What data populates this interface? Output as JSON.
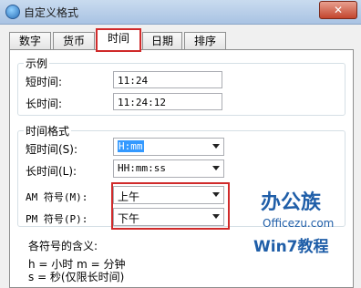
{
  "window": {
    "title": "自定义格式",
    "close_label": "✕"
  },
  "tabs": [
    {
      "label": "数字"
    },
    {
      "label": "货币"
    },
    {
      "label": "时间"
    },
    {
      "label": "日期"
    },
    {
      "label": "排序"
    }
  ],
  "example": {
    "group_title": "示例",
    "short_label": "短时间:",
    "short_value": "11:24",
    "long_label": "长时间:",
    "long_value": "11:24:12"
  },
  "time_format": {
    "group_title": "时间格式",
    "short_label": "短时间(S):",
    "short_value": "H:mm",
    "long_label": "长时间(L):",
    "long_value": "HH:mm:ss",
    "am_label": "AM 符号(M):",
    "am_value": "上午",
    "pm_label": "PM 符号(P):",
    "pm_value": "下午"
  },
  "meaning": {
    "title": "各符号的含义:",
    "line1": "h = 小时    m = 分钟",
    "line2": "s = 秒(仅限长时间)"
  },
  "watermark": {
    "logo": "办公族",
    "site": "Officezu.com",
    "tagline": "Win7教程"
  },
  "colors": {
    "highlight": "#d02a2a",
    "selection": "#3399ff",
    "brand": "#1f5ea8"
  }
}
